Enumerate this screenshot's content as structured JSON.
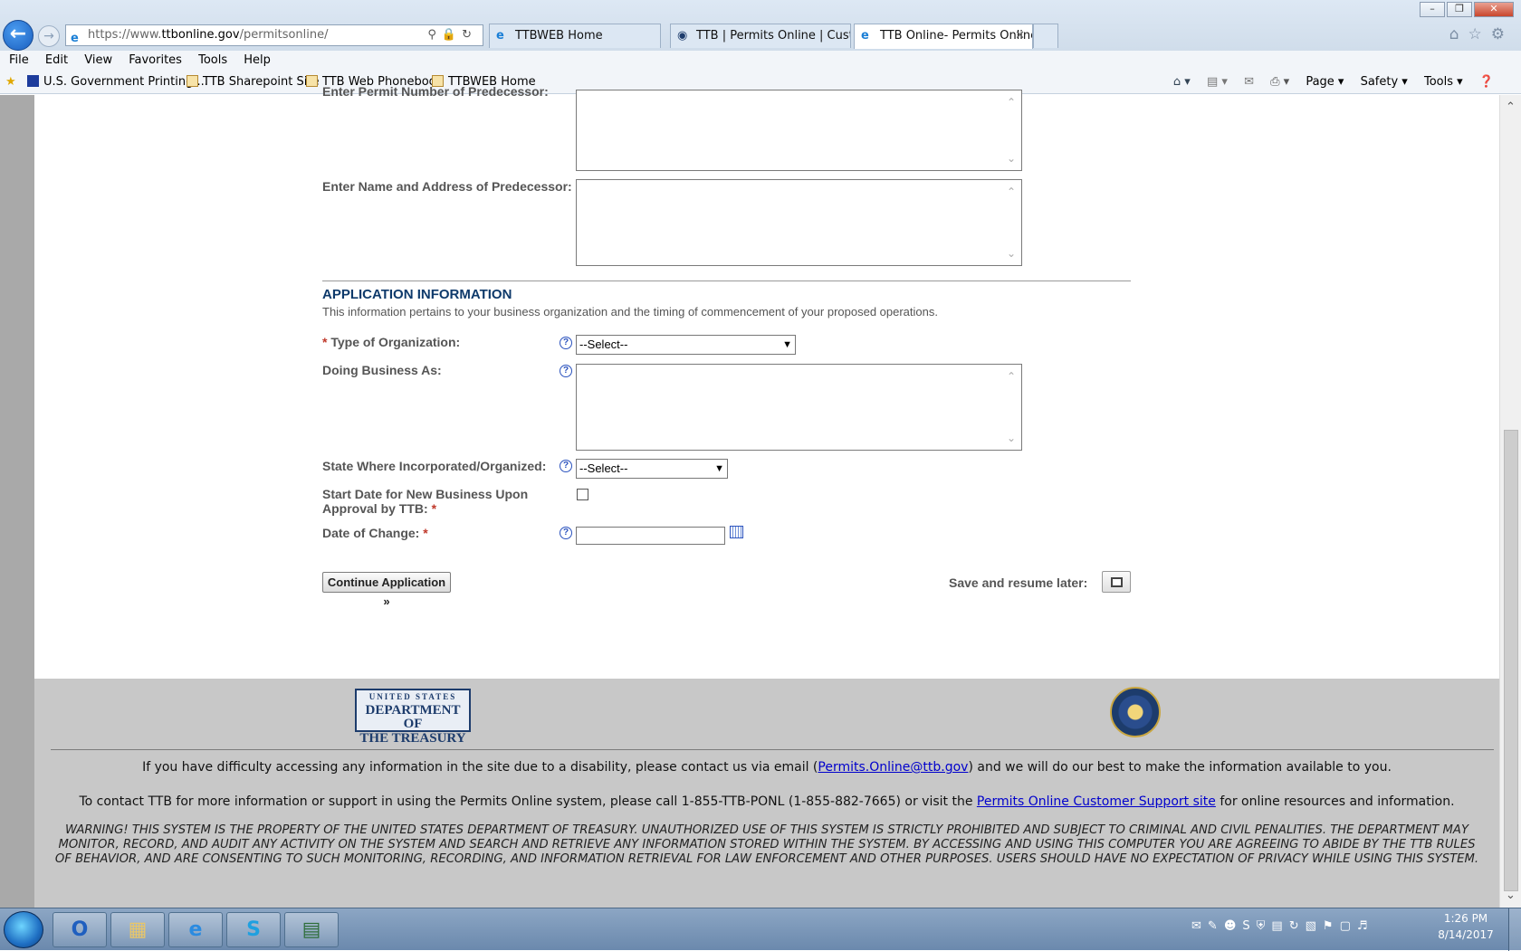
{
  "browser": {
    "url_prefix": "https://www.",
    "url_domain": "ttbonline.gov",
    "url_path": "/permitsonline/",
    "tabs": [
      {
        "label": "TTBWEB Home"
      },
      {
        "label": "TTB | Permits Online | Custom..."
      },
      {
        "label": "TTB Online- Permits Online..."
      }
    ],
    "menu": [
      "File",
      "Edit",
      "View",
      "Favorites",
      "Tools",
      "Help"
    ],
    "favorites": [
      "U.S. Government Printing ...",
      "TTB Sharepoint Site",
      "TTB Web Phonebook",
      "TTBWEB Home"
    ],
    "command_bar": [
      "Page ▾",
      "Safety ▾",
      "Tools ▾"
    ]
  },
  "form": {
    "predecessor_permit_label": "Enter Permit Number of Predecessor:",
    "predecessor_name_label": "Enter Name and Address of Predecessor:",
    "section_title": "APPLICATION INFORMATION",
    "section_desc": "This information pertains to your business organization and the timing of commencement of your proposed operations.",
    "org_type_label": "Type of Organization:",
    "org_type_value": "--Select--",
    "dba_label": "Doing Business As:",
    "state_label": "State Where Incorporated/Organized:",
    "state_value": "--Select--",
    "start_date_label_1": "Start Date for New Business Upon",
    "start_date_label_2": "Approval by TTB:",
    "date_change_label": "Date of Change:",
    "required_marker": "*",
    "continue_button": "Continue Application »",
    "save_label": "Save and resume later:"
  },
  "footer": {
    "logo_line1": "UNITED STATES",
    "logo_line2": "DEPARTMENT OF",
    "logo_line3": "THE TREASURY",
    "access_pre": "If you have difficulty accessing any information in the site due to a disability, please contact us via email (",
    "access_email": "Permits.Online@ttb.gov",
    "access_post": ") and we will do our best to make the information available to you.",
    "contact_pre": "To contact TTB for more information or support in using the Permits Online system, please call 1-855-TTB-PONL (1-855-882-7665) or visit the ",
    "contact_link": "Permits Online Customer Support site",
    "contact_post": " for online resources and information.",
    "warning": "WARNING! THIS SYSTEM IS THE PROPERTY OF THE UNITED STATES DEPARTMENT OF TREASURY. UNAUTHORIZED USE OF THIS SYSTEM IS STRICTLY PROHIBITED AND SUBJECT TO CRIMINAL AND CIVIL PENALITIES. THE DEPARTMENT MAY MONITOR, RECORD, AND AUDIT ANY ACTIVITY ON THE SYSTEM AND SEARCH AND RETRIEVE ANY INFORMATION STORED WITHIN THE SYSTEM. BY ACCESSING AND USING THIS COMPUTER YOU ARE AGREEING TO ABIDE BY THE TTB RULES OF BEHAVIOR, AND ARE CONSENTING TO SUCH MONITORING, RECORDING, AND INFORMATION RETRIEVAL FOR LAW ENFORCEMENT AND OTHER PURPOSES. USERS SHOULD HAVE NO EXPECTATION OF PRIVACY WHILE USING THIS SYSTEM."
  },
  "taskbar": {
    "time": "1:26 PM",
    "date": "8/14/2017"
  },
  "icons": [
    "back-arrow-icon",
    "forward-arrow-icon",
    "ie-icon",
    "search-icon",
    "lock-icon",
    "refresh-icon",
    "home-icon",
    "star-icon",
    "gear-icon",
    "help-icon",
    "calendar-icon",
    "save-icon",
    "treasury-seal-icon"
  ],
  "colors": {
    "section_title": "#0e3a6b",
    "required": "#c0392b",
    "link": "#0000cc",
    "footer_bg": "#c8c8c8"
  }
}
